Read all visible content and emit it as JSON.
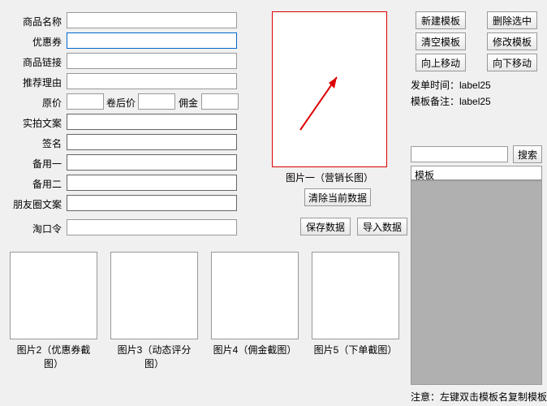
{
  "labels": {
    "product_name": "商品名称",
    "coupon": "优惠券",
    "product_link": "商品链接",
    "recommend_reason": "推荐理由",
    "orig_price": "原价",
    "after_coupon": "卷后价",
    "commission": "佣金",
    "real_shot": "实拍文案",
    "signature": "签名",
    "remark1": "备用一",
    "remark2": "备用二",
    "moments": "朋友圈文案",
    "taokouling": "淘口令"
  },
  "img": {
    "p1": "图片一（营销长图）",
    "p2": "图片2（优惠券截图）",
    "p3": "图片3（动态评分图）",
    "p4": "图片4（佣金截图）",
    "p5": "图片5（下单截图）"
  },
  "buttons": {
    "clear_current": "清除当前数据",
    "save": "保存数据",
    "import": "导入数据",
    "new_tpl": "新建模板",
    "del_sel": "删除选中",
    "clear_tpl": "清空模板",
    "edit_tpl": "修改模板",
    "move_up": "向上移动",
    "move_down": "向下移动",
    "search": "搜索"
  },
  "right": {
    "order_time": "发单时间：label25",
    "tpl_remark": "模板备注：label25",
    "list_header": "模板"
  },
  "note": "注意：左键双击模板名复制模板"
}
